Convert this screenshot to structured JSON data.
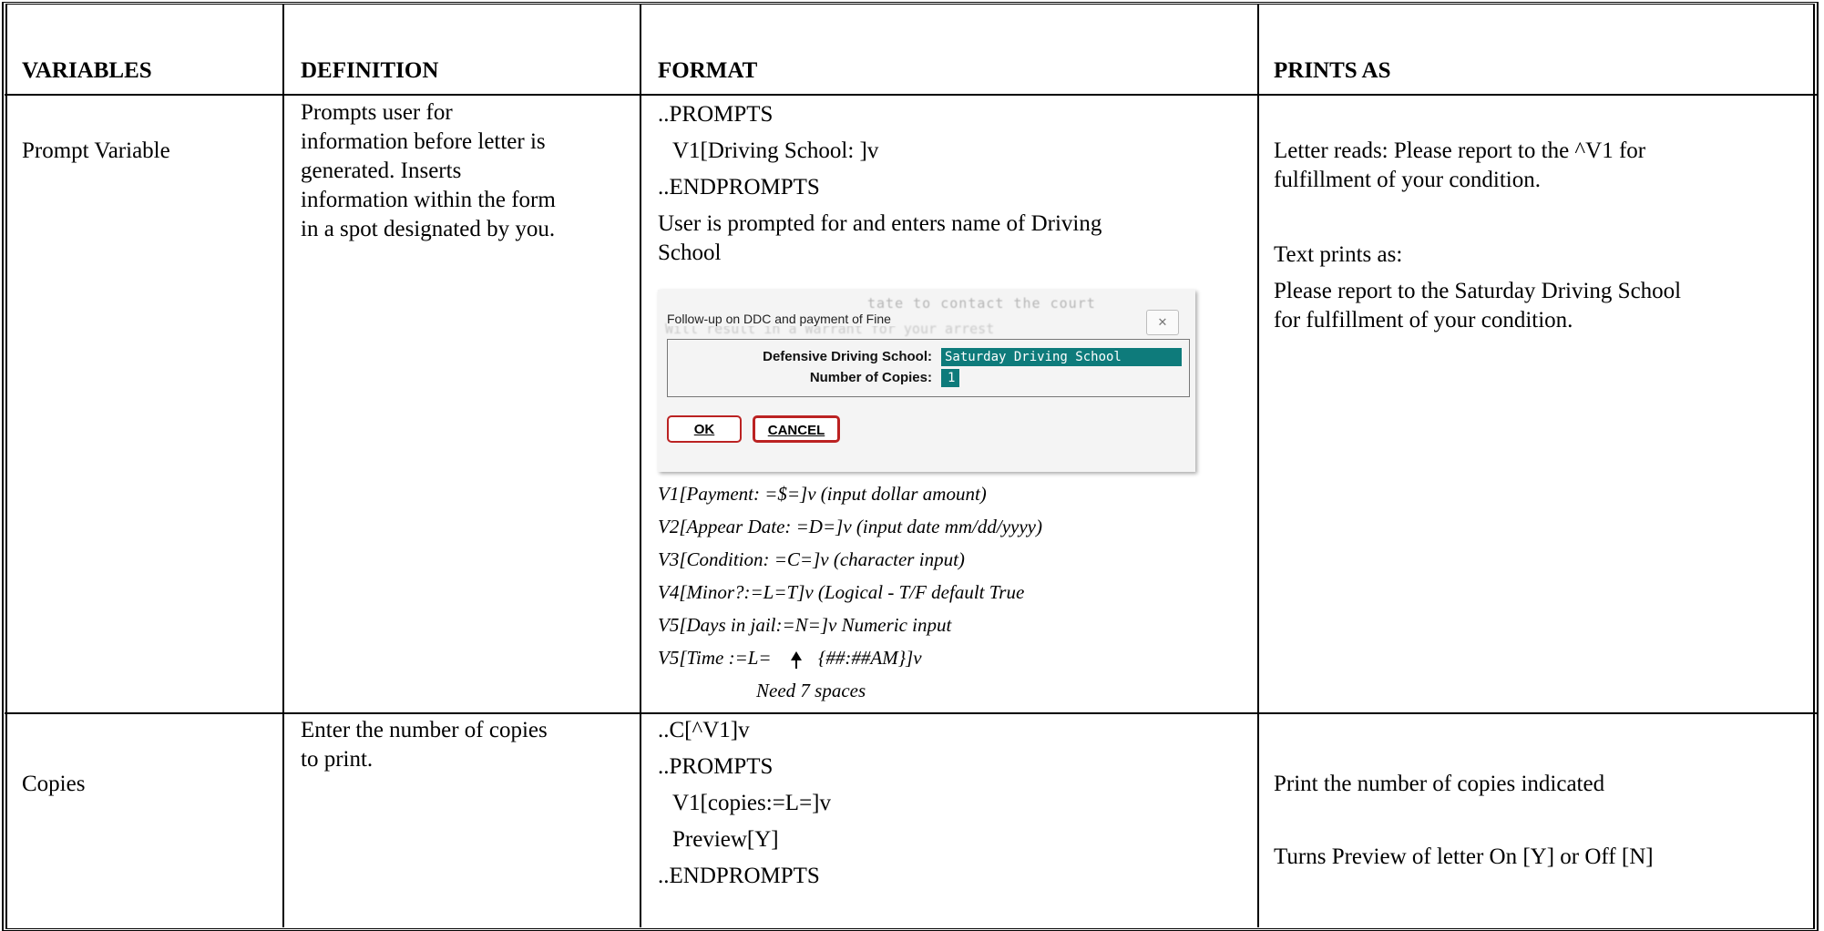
{
  "headers": [
    "VARIABLES",
    "DEFINITION",
    "FORMAT",
    "PRINTS AS"
  ],
  "row1": {
    "variable": "Prompt Variable",
    "definition": [
      "Prompts user for",
      "information before letter is",
      "generated.  Inserts",
      "information within the form",
      "in a spot designated by you."
    ],
    "format_lines": [
      "..PROMPTS",
      "V1[Driving School: ]v",
      "..ENDPROMPTS",
      "User is prompted for and enters name of Driving",
      "School"
    ],
    "dialog": {
      "title": "Follow-up on DDC and payment of Fine",
      "close": "✕",
      "ghost1": "tate to contact the court",
      "ghost2": "Will result in a Warrant for your arrest",
      "label1": "Defensive Driving School:",
      "value1": "Saturday Driving School",
      "label2": "Number of Copies:",
      "value2": "1",
      "ok": "OK",
      "cancel": "CANCEL"
    },
    "italic_lines": [
      "V1[Payment: =$=]v (input dollar amount)",
      "V2[Appear Date: =D=]v (input date mm/dd/yyyy)",
      "V3[Condition: =C=]v (character input)",
      "V4[Minor?:=L=T]v (Logical - T/F default True",
      "V5[Days in jail:=N=]v Numeric input"
    ],
    "time_line_a": "V5[Time :=L=",
    "time_line_b": "{##:##AM}]v",
    "note": "Need 7 spaces",
    "prints_as": [
      "Letter reads: Please report to the ^V1 for",
      "fulfillment of your condition.",
      "Text prints as:",
      "Please report to the Saturday Driving School",
      "for fulfillment of your condition."
    ]
  },
  "row2": {
    "variable": "Copies",
    "definition": [
      "Enter the number of copies",
      "to print."
    ],
    "format_lines": [
      "..C[^V1]v",
      "..PROMPTS",
      "V1[copies:=L=]v",
      "Preview[Y]",
      "..ENDPROMPTS"
    ],
    "prints_as": [
      "Print the number of copies indicated",
      "Turns Preview of letter On [Y] or Off [N]"
    ]
  }
}
